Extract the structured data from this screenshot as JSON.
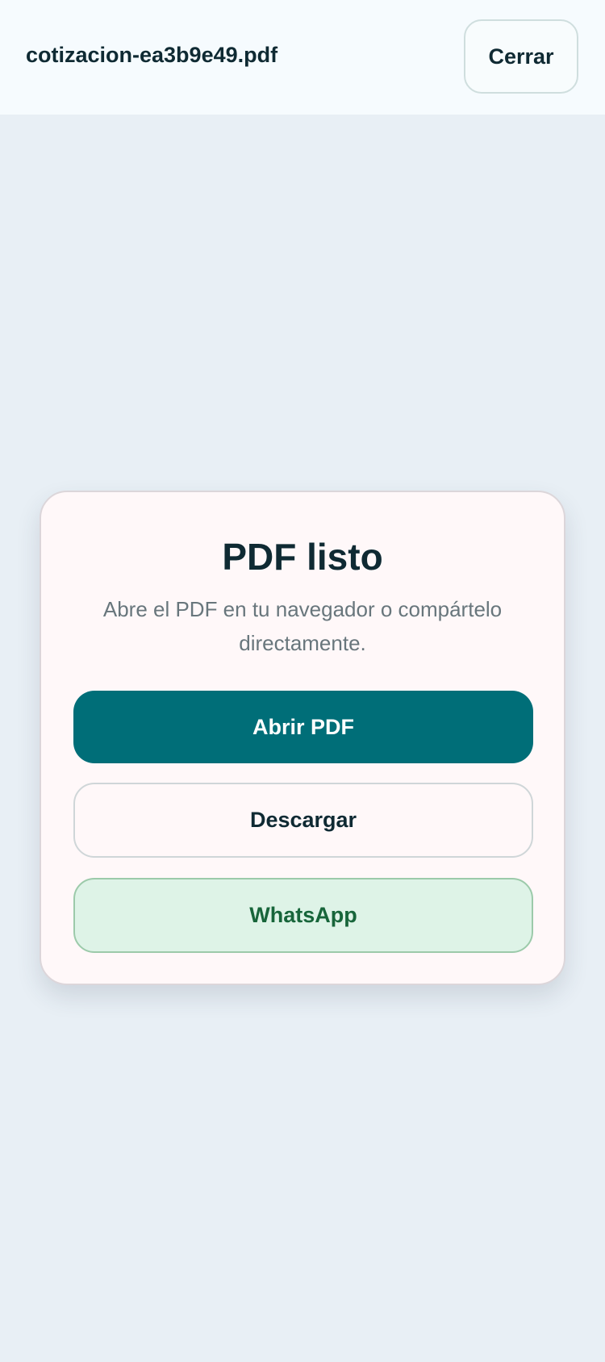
{
  "header": {
    "filename": "cotizacion-ea3b9e49.pdf",
    "close_label": "Cerrar"
  },
  "card": {
    "title": "PDF listo",
    "description": "Abre el PDF en tu navegador o compártelo directamente.",
    "open_label": "Abrir PDF",
    "download_label": "Descargar",
    "whatsapp_label": "WhatsApp"
  },
  "colors": {
    "primary": "#006e78",
    "background": "#e8eff5",
    "whatsapp_bg": "#def3e7",
    "whatsapp_text": "#17653a"
  }
}
